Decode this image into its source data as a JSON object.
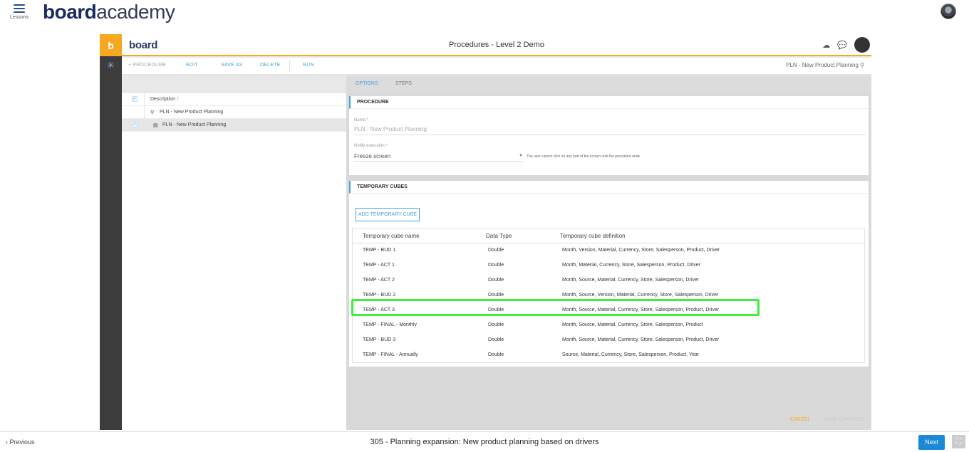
{
  "academy": {
    "lessons_label": "Lessons",
    "logo_bold": "board",
    "logo_thin": "academy"
  },
  "app": {
    "rail_logo": "b",
    "wordmark": "board",
    "page_title": "Procedures - Level 2 Demo"
  },
  "toolbar": {
    "new_procedure": "+ PROCEDURE",
    "edit": "EDIT",
    "save_as": "SAVE AS",
    "delete": "DELETE",
    "run": "RUN",
    "search_value": "PLN - New Product Planning"
  },
  "list": {
    "header": "Description ↑",
    "search_row": "PLN - New Product Planning",
    "items": [
      {
        "label": "PLN - New Product Planning"
      }
    ]
  },
  "detail": {
    "tabs": {
      "options": "OPTIONS",
      "steps": "STEPS"
    },
    "procedure_card": {
      "title": "PROCEDURE",
      "name_label": "Name *",
      "name_value": "PLN - New Product Planning",
      "notify_label": "Notify execution *",
      "notify_value": "Freeze screen",
      "notify_hint": "The user cannot click on any part of the screen until the procedure ends"
    },
    "temp_card": {
      "title": "TEMPORARY CUBES",
      "add_button": "ADD TEMPORARY CUBE",
      "columns": [
        "Temporary cube name",
        "Data Type",
        "Temporary cube definition"
      ],
      "rows": [
        [
          "TEMP - BUD 1",
          "Double",
          "Month, Version, Material, Currency, Store, Salesperson, Product, Driver"
        ],
        [
          "TEMP - ACT 1",
          "Double",
          "Month, Material, Currency, Store, Salesperson, Product, Driver"
        ],
        [
          "TEMP - ACT 2",
          "Double",
          "Month, Source, Material, Currency, Store, Salesperson, Driver"
        ],
        [
          "TEMP - BUD 2",
          "Double",
          "Month, Source, Version, Material, Currency, Store, Salesperson, Driver"
        ],
        [
          "TEMP - ACT 3",
          "Double",
          "Month, Source, Material, Currency, Store, Salesperson, Product, Driver"
        ],
        [
          "TEMP - FINAL - Monthly",
          "Double",
          "Month, Source, Material, Currency, Store, Salesperson, Product"
        ],
        [
          "TEMP - BUD 3",
          "Double",
          "Month, Source, Material, Currency, Store, Salesperson, Product, Driver"
        ],
        [
          "TEMP - FINAL - Annually",
          "Double",
          "Source, Material, Currency, Store, Salesperson, Product, Year"
        ]
      ],
      "highlighted_row": "TEMP - ACT 3"
    },
    "cancel": "CANCEL",
    "save_changes": "SAVE CHANGES"
  },
  "bottom_nav": {
    "previous": "‹ Previous",
    "lesson_title": "305 - Planning expansion: New product planning based on drivers",
    "next": "Next"
  },
  "colors": {
    "accent": "#4aa3df",
    "brand_orange": "#f7a823",
    "highlight": "#3cf03c"
  }
}
